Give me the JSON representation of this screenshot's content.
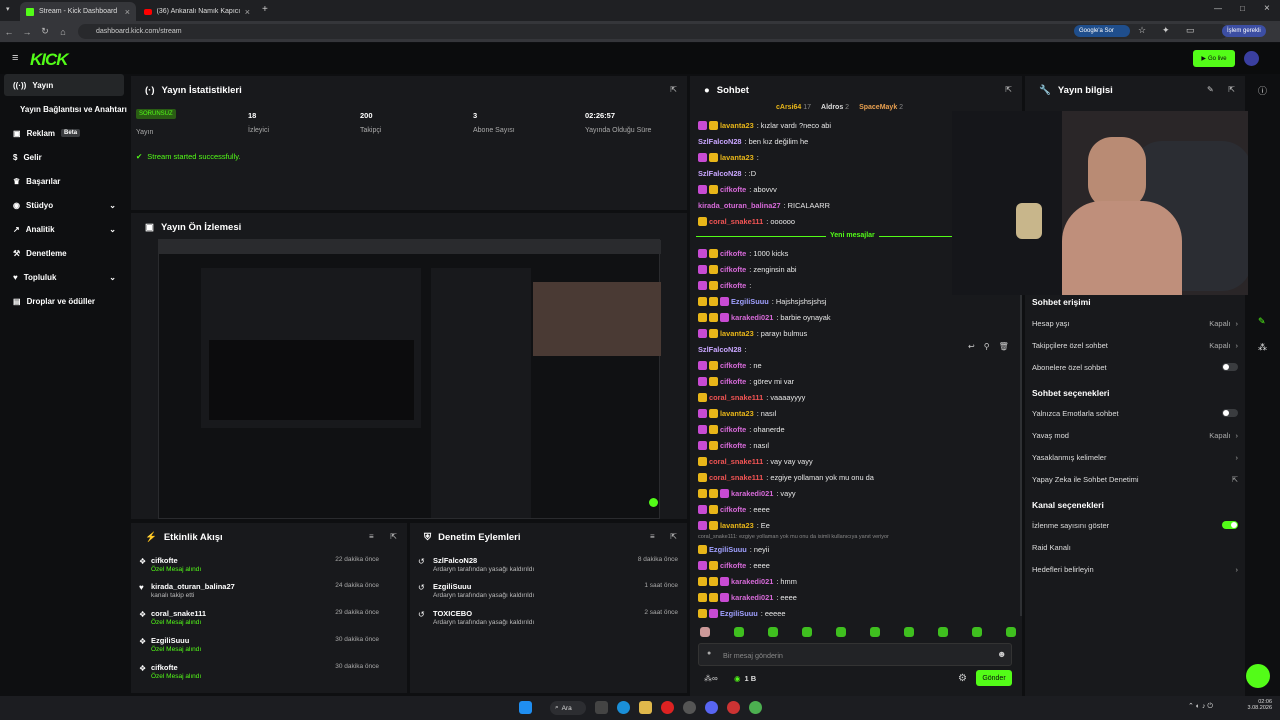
{
  "browser": {
    "tabs": [
      {
        "title": "Stream - Kick Dashboard"
      },
      {
        "title": "(36) Ankaralı Namık Kapıcı İzzet"
      }
    ],
    "url": "dashboard.kick.com/stream",
    "google_btn": "Google'a Sor",
    "profile_btn": "İşlem gerekli"
  },
  "header": {
    "logo": "KICK",
    "go_live": "Go live"
  },
  "sidebar": {
    "items": [
      {
        "label": "Yayın",
        "icon": "broadcast-icon"
      },
      {
        "label": "Yayın Bağlantısı ve Anahtarı"
      },
      {
        "label": "Reklam",
        "badge": "Beta",
        "icon": "ad-icon"
      },
      {
        "label": "Gelir",
        "icon": "revenue-icon"
      },
      {
        "label": "Başarılar",
        "icon": "trophy-icon"
      },
      {
        "label": "Stüdyo",
        "icon": "studio-icon"
      },
      {
        "label": "Analitik",
        "icon": "analytics-icon"
      },
      {
        "label": "Denetleme",
        "icon": "moderation-icon"
      },
      {
        "label": "Topluluk",
        "icon": "community-icon"
      },
      {
        "label": "Droplar ve ödüller",
        "icon": "gift-icon"
      }
    ]
  },
  "stats": {
    "title": "Yayın İstatistikleri",
    "status_badge": "SORUNSUZ",
    "status_label": "Yayın",
    "viewers": "18",
    "viewers_label": "İzleyici",
    "followers": "200",
    "followers_label": "Takipçi",
    "subs": "3",
    "subs_label": "Abone Sayısı",
    "uptime": "02:26:57",
    "uptime_label": "Yayında Olduğu Süre",
    "message": "Stream started successfully."
  },
  "preview": {
    "title": "Yayın Ön İzlemesi"
  },
  "activity": {
    "title": "Etkinlik Akışı",
    "items": [
      {
        "name": "cifkofte",
        "desc": "Özel Mesaj alındı",
        "time": "22 dakika önce"
      },
      {
        "name": "kirada_oturan_balina27",
        "desc": "kanalı takip etti",
        "time": "24 dakika önce"
      },
      {
        "name": "coral_snake111",
        "desc": "Özel Mesaj alındı",
        "time": "29 dakika önce"
      },
      {
        "name": "EzgiliSuuu",
        "desc": "Özel Mesaj alındı",
        "time": "30 dakika önce"
      },
      {
        "name": "cifkofte",
        "desc": "Özel Mesaj alındı",
        "time": "30 dakika önce"
      }
    ]
  },
  "modlog": {
    "title": "Denetim Eylemleri",
    "items": [
      {
        "name": "SzlFalcoN28",
        "desc": "Ardaryn tarafından yasağı kaldırıldı",
        "time": "8 dakika önce"
      },
      {
        "name": "EzgiliSuuu",
        "desc": "Ardaryn tarafından yasağı kaldırıldı",
        "time": "1 saat önce"
      },
      {
        "name": "TOXICEBO",
        "desc": "Ardaryn tarafından yasağı kaldırıldı",
        "time": "2 saat önce"
      }
    ]
  },
  "chat": {
    "title": "Sohbet",
    "top_gifters": [
      {
        "name": "cArsi64",
        "count": "17"
      },
      {
        "name": "Aldros",
        "count": "2"
      },
      {
        "name": "SpaceMayk",
        "count": "2"
      }
    ],
    "new_messages": "Yeni mesajlar",
    "messages": [
      {
        "user": "lavanta23",
        "text": ": kızlar vardı ?neco abi",
        "color": "#e8b619",
        "badges": [
          "p",
          "y"
        ]
      },
      {
        "user": "SzlFalcoN28",
        "text": ": ben kız değilim he",
        "color": "#c9a6ff",
        "badges": []
      },
      {
        "user": "lavanta23",
        "text": ":",
        "color": "#e8b619",
        "badges": [
          "p",
          "y"
        ]
      },
      {
        "user": "SzlFalcoN28",
        "text": ": :D",
        "color": "#c9a6ff",
        "badges": []
      },
      {
        "user": "cifkofte",
        "text": ": abovvv",
        "color": "#d76ad9",
        "badges": [
          "p",
          "y"
        ]
      },
      {
        "user": "kirada_oturan_balina27",
        "text": ": RICALAARR",
        "color": "#d76ad9",
        "badges": []
      },
      {
        "user": "coral_snake111",
        "text": ": oooooo",
        "color": "#f25454",
        "badges": [
          "y"
        ]
      },
      {
        "user": "cifkofte",
        "text": ": 1000 kicks",
        "color": "#d76ad9",
        "badges": [
          "p",
          "y"
        ]
      },
      {
        "user": "cifkofte",
        "text": ": zenginsin abi",
        "color": "#d76ad9",
        "badges": [
          "p",
          "y"
        ]
      },
      {
        "user": "cifkofte",
        "text": ":",
        "color": "#d76ad9",
        "badges": [
          "p",
          "y"
        ]
      },
      {
        "user": "EzgiliSuuu",
        "text": ": Hajshsjshsjshsj",
        "color": "#a0a0ff",
        "badges": [
          "y",
          "y",
          "p"
        ]
      },
      {
        "user": "karakedi021",
        "text": ": barbie oynayak",
        "color": "#d76ad9",
        "badges": [
          "y",
          "y",
          "p"
        ]
      },
      {
        "user": "lavanta23",
        "text": ": parayı bulmus",
        "color": "#e8b619",
        "badges": [
          "p",
          "y"
        ]
      },
      {
        "user": "SzlFalcoN28",
        "text": ":",
        "color": "#c9a6ff",
        "badges": []
      },
      {
        "user": "cifkofte",
        "text": ": ne",
        "color": "#d76ad9",
        "badges": [
          "p",
          "y"
        ]
      },
      {
        "user": "cifkofte",
        "text": ": görev mi var",
        "color": "#d76ad9",
        "badges": [
          "p",
          "y"
        ]
      },
      {
        "user": "coral_snake111",
        "text": ": vaaaayyyy",
        "color": "#f25454",
        "badges": [
          "y"
        ]
      },
      {
        "user": "lavanta23",
        "text": ": nasıl",
        "color": "#e8b619",
        "badges": [
          "p",
          "y"
        ]
      },
      {
        "user": "cifkofte",
        "text": ": ohanerde",
        "color": "#d76ad9",
        "badges": [
          "p",
          "y"
        ]
      },
      {
        "user": "cifkofte",
        "text": ": nasıl",
        "color": "#d76ad9",
        "badges": [
          "p",
          "y"
        ]
      },
      {
        "user": "coral_snake111",
        "text": ": vay vay vayy",
        "color": "#f25454",
        "badges": [
          "y"
        ]
      },
      {
        "user": "coral_snake111",
        "text": ": ezgiye yollaman yok mu onu da",
        "color": "#f25454",
        "badges": [
          "y"
        ]
      },
      {
        "user": "karakedi021",
        "text": ": vayy",
        "color": "#d76ad9",
        "badges": [
          "y",
          "y",
          "p"
        ]
      },
      {
        "user": "cifkofte",
        "text": ": eeee",
        "color": "#d76ad9",
        "badges": [
          "p",
          "y"
        ]
      },
      {
        "user": "lavanta23",
        "text": ": Ee",
        "color": "#e8b619",
        "badges": [
          "p",
          "y"
        ]
      },
      {
        "user": "EzgiliSuuu",
        "text": ": neyii",
        "color": "#a0a0ff",
        "badges": [
          "y"
        ]
      },
      {
        "user": "cifkofte",
        "text": ": eeee",
        "color": "#d76ad9",
        "badges": [
          "p",
          "y"
        ]
      },
      {
        "user": "karakedi021",
        "text": ": hmm",
        "color": "#d76ad9",
        "badges": [
          "y",
          "y",
          "p"
        ]
      },
      {
        "user": "karakedi021",
        "text": ": eeee",
        "color": "#d76ad9",
        "badges": [
          "y",
          "y",
          "p"
        ]
      },
      {
        "user": "EzgiliSuuu",
        "text": ": eeeee",
        "color": "#a0a0ff",
        "badges": [
          "y",
          "p"
        ]
      }
    ],
    "reply_context": "coral_snake111: ezgiye yollaman yok mu onu da isimli kullanıcıya yanıt veriyor",
    "input_placeholder": "Bir mesaj gönderin",
    "points": "1 B",
    "send": "Gönder"
  },
  "info": {
    "title": "Yayın bilgisi",
    "chat_access_title": "Sohbet erişimi",
    "rows_access": [
      {
        "label": "Hesap yaşı",
        "value": "Kapalı"
      },
      {
        "label": "Takipçilere özel sohbet",
        "value": "Kapalı"
      },
      {
        "label": "Abonelere özel sohbet",
        "value": ""
      }
    ],
    "chat_options_title": "Sohbet seçenekleri",
    "rows_options": [
      {
        "label": "Yalnızca Emotlarla sohbet",
        "value": ""
      },
      {
        "label": "Yavaş mod",
        "value": "Kapalı"
      },
      {
        "label": "Yasaklanmış kelimeler",
        "value": ""
      },
      {
        "label": "Yapay Zeka ile Sohbet Denetimi",
        "value": ""
      }
    ],
    "channel_options_title": "Kanal seçenekleri",
    "rows_channel": [
      {
        "label": "İzlenme sayısını göster",
        "value": ""
      },
      {
        "label": "Raid Kanalı",
        "value": ""
      },
      {
        "label": "Hedefleri belirleyin",
        "value": ""
      }
    ]
  },
  "taskbar": {
    "search": "Ara",
    "time": "02:06",
    "date": "3.08.2026"
  },
  "colors": {
    "accent": "#53fc18",
    "panel": "#18191c",
    "bg": "#0e0f11"
  }
}
